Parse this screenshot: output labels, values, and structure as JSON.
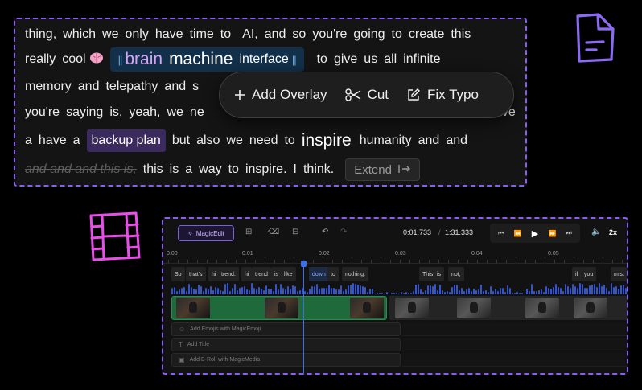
{
  "transcript": {
    "line1": [
      "thing,",
      "which",
      "we",
      "only",
      "have",
      "time",
      "to",
      "AI,",
      "and",
      "so",
      "you're",
      "going",
      "to",
      "create",
      "this"
    ],
    "line2_pre": [
      "really",
      "cool"
    ],
    "brain_chip": {
      "word1": "brain",
      "word2": "machine",
      "word3": "interface"
    },
    "line2_post": [
      "to",
      "give",
      "us",
      "all",
      "infinite"
    ],
    "line3": [
      "memory",
      "and",
      "telepathy",
      "and",
      "s"
    ],
    "line4_pre": [
      "you're",
      "saying",
      "is,",
      "yeah,",
      "we",
      "ne"
    ],
    "line4_post": "ave",
    "line5_pre": [
      "a",
      "have",
      "a"
    ],
    "backup_plan": "backup plan",
    "line5_mid": [
      "but",
      "also",
      "we",
      "need",
      "to"
    ],
    "inspire": "inspire",
    "line5_post": [
      "humanity",
      "and",
      "and"
    ],
    "struck": "and and and this is,",
    "line6": [
      "this",
      "is",
      "a",
      "way",
      "to",
      "inspire.",
      "I",
      "think."
    ],
    "extend_label": "Extend"
  },
  "popup": {
    "add_overlay": "Add Overlay",
    "cut": "Cut",
    "fix_typo": "Fix Typo"
  },
  "timeline": {
    "magic_edit": "MagicEdit",
    "current_time": "0:01.733",
    "separator": "/",
    "total_time": "1:31.333",
    "speed": "2x",
    "ruler": [
      "0:00",
      "0:01",
      "0:02",
      "0:03",
      "0:04",
      "0:05"
    ],
    "words": [
      "So",
      "that's",
      "hi",
      "trend.",
      "hi",
      "trend",
      "is",
      "like",
      "down",
      "to",
      "nothing.",
      "This",
      "is",
      "not,",
      "if",
      "you",
      "mist"
    ],
    "add_rows": [
      "Add Emojis with MagicEmoji",
      "Add Title",
      "Add B-Roll with MagicMedia"
    ]
  },
  "colors": {
    "accent_purple": "#8b5cf6",
    "magenta_icon": "#e84fe8",
    "playhead_blue": "#3f6fe8",
    "clip_green": "#1f6a3a"
  },
  "icons": [
    "document-icon",
    "film-icon",
    "brain-emoji-icon",
    "plus-icon",
    "scissors-icon",
    "edit-icon",
    "extend-icon"
  ]
}
